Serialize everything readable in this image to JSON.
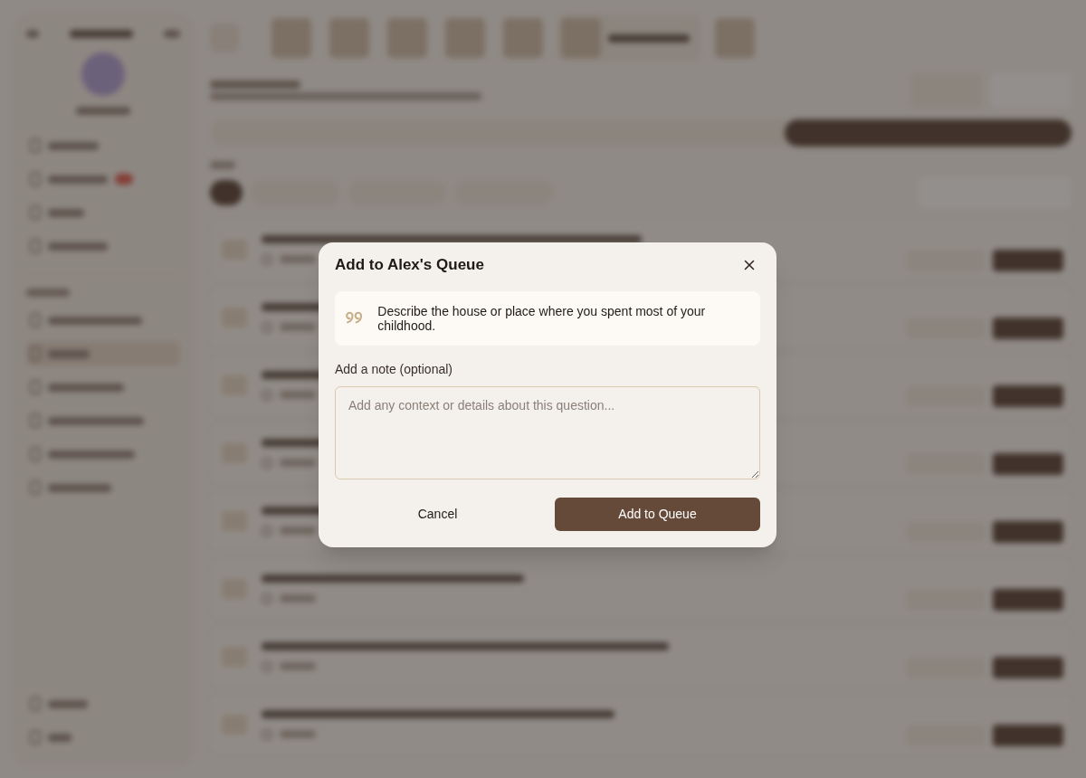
{
  "modal": {
    "title": "Add to Alex's Queue",
    "question": "Describe the house or place where you spent most of your childhood.",
    "note_label": "Add a note (optional)",
    "note_placeholder": "Add any context or details about this question...",
    "buttons": [
      {
        "label": "Cancel",
        "kind": "secondary"
      },
      {
        "label": "Add to Queue",
        "kind": "primary"
      }
    ]
  }
}
